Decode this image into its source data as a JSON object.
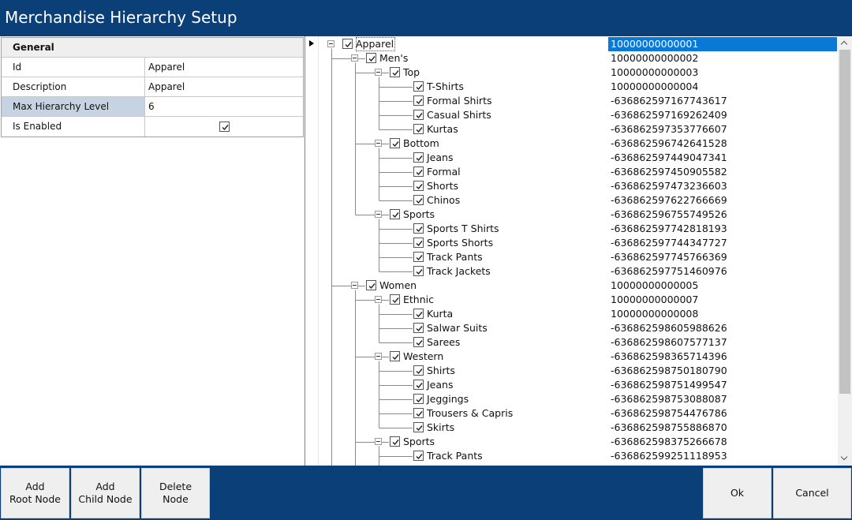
{
  "window": {
    "title": "Merchandise Hierarchy Setup"
  },
  "properties": {
    "category": "General",
    "rows": [
      {
        "name": "Id",
        "value": "Apparel"
      },
      {
        "name": "Description",
        "value": "Apparel"
      },
      {
        "name": "Max Hierarchy Level",
        "value": "6"
      },
      {
        "name": "Is Enabled",
        "value": ""
      }
    ]
  },
  "tree": {
    "nodes": [
      {
        "label": "Apparel",
        "code": "10000000000001",
        "level": 0
      },
      {
        "label": "Men's",
        "code": "10000000000002",
        "level": 1
      },
      {
        "label": "Top",
        "code": "10000000000003",
        "level": 2
      },
      {
        "label": "T-Shirts",
        "code": "10000000000004",
        "level": 3
      },
      {
        "label": "Formal Shirts",
        "code": "-636862597167743617",
        "level": 3
      },
      {
        "label": "Casual Shirts",
        "code": "-636862597169262409",
        "level": 3
      },
      {
        "label": "Kurtas",
        "code": "-636862597353776607",
        "level": 3
      },
      {
        "label": "Bottom",
        "code": "-636862596742641528",
        "level": 2
      },
      {
        "label": "Jeans",
        "code": "-636862597449047341",
        "level": 3
      },
      {
        "label": "Formal",
        "code": "-636862597450905582",
        "level": 3
      },
      {
        "label": "Shorts",
        "code": "-636862597473236603",
        "level": 3
      },
      {
        "label": "Chinos",
        "code": "-636862597622766669",
        "level": 3
      },
      {
        "label": "Sports",
        "code": "-636862596755749526",
        "level": 2
      },
      {
        "label": "Sports T Shirts",
        "code": "-636862597742818193",
        "level": 3
      },
      {
        "label": "Sports Shorts",
        "code": "-636862597744347727",
        "level": 3
      },
      {
        "label": "Track Pants",
        "code": "-636862597745766369",
        "level": 3
      },
      {
        "label": "Track Jackets",
        "code": "-636862597751460976",
        "level": 3
      },
      {
        "label": "Women",
        "code": "10000000000005",
        "level": 1
      },
      {
        "label": "Ethnic",
        "code": "10000000000007",
        "level": 2
      },
      {
        "label": "Kurta",
        "code": "10000000000008",
        "level": 3
      },
      {
        "label": "Salwar Suits",
        "code": "-636862598605988626",
        "level": 3
      },
      {
        "label": "Sarees",
        "code": "-636862598607577137",
        "level": 3
      },
      {
        "label": "Western",
        "code": "-636862598365714396",
        "level": 2
      },
      {
        "label": "Shirts",
        "code": "-636862598750180790",
        "level": 3
      },
      {
        "label": "Jeans",
        "code": "-636862598751499547",
        "level": 3
      },
      {
        "label": "Jeggings",
        "code": "-636862598753088087",
        "level": 3
      },
      {
        "label": "Trousers & Capris",
        "code": "-636862598754476786",
        "level": 3
      },
      {
        "label": "Skirts",
        "code": "-636862598755886870",
        "level": 3
      },
      {
        "label": "Sports",
        "code": "-636862598375266678",
        "level": 2
      },
      {
        "label": "Track Pants",
        "code": "-636862599251118953",
        "level": 3
      }
    ]
  },
  "buttons": {
    "add_root": "Add\nRoot Node",
    "add_child": "Add\nChild Node",
    "delete": "Delete\nNode",
    "ok": "Ok",
    "cancel": "Cancel"
  },
  "colors": {
    "title_bar": "#0b3f78",
    "selection": "#0a78d7",
    "selected_property": "#c6d3e2"
  },
  "icons": {
    "row_indicator": "triangle-right-icon",
    "toggle": "collapse-minus-icon",
    "check": "checkbox-checked-icon"
  }
}
